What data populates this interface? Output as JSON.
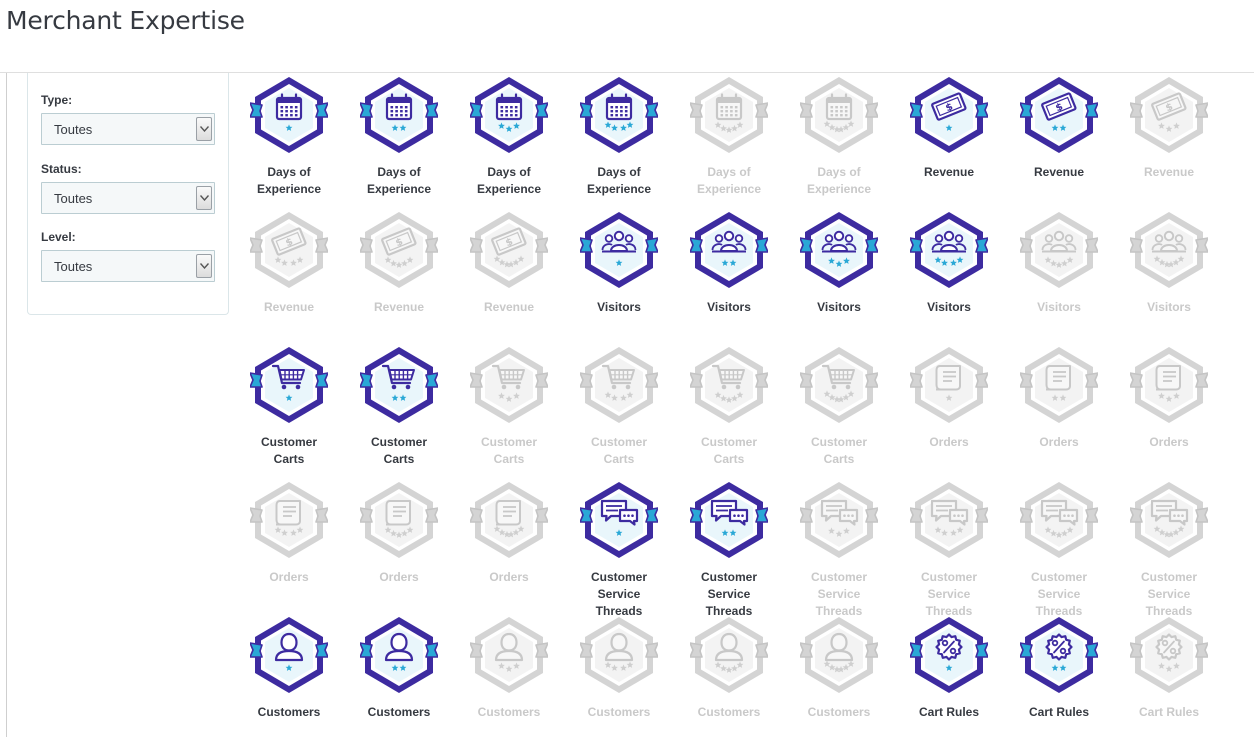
{
  "page": {
    "title": "Merchant Expertise"
  },
  "filters": {
    "type": {
      "label": "Type:",
      "value": "Toutes"
    },
    "status": {
      "label": "Status:",
      "value": "Toutes"
    },
    "level": {
      "label": "Level:",
      "value": "Toutes"
    }
  },
  "colors": {
    "active_hex": "#3d2ba0",
    "active_ribbon": "#2aa8d6",
    "active_fill": "#e9f6fb",
    "star": "#2aa8d6",
    "locked": "#d4d4d4",
    "locked_fill": "#f3f3f3"
  },
  "badges": [
    {
      "name": "Days of Experience",
      "icon": "calendar-icon",
      "stars": 1,
      "unlocked": true
    },
    {
      "name": "Days of Experience",
      "icon": "calendar-icon",
      "stars": 2,
      "unlocked": true
    },
    {
      "name": "Days of Experience",
      "icon": "calendar-icon",
      "stars": 3,
      "unlocked": true
    },
    {
      "name": "Days of Experience",
      "icon": "calendar-icon",
      "stars": 4,
      "unlocked": true
    },
    {
      "name": "Days of Experience",
      "icon": "calendar-icon",
      "stars": 5,
      "unlocked": false
    },
    {
      "name": "Days of Experience",
      "icon": "calendar-icon",
      "stars": 6,
      "unlocked": false
    },
    {
      "name": "Revenue",
      "icon": "money-bill-icon",
      "stars": 1,
      "unlocked": true
    },
    {
      "name": "Revenue",
      "icon": "money-bill-icon",
      "stars": 2,
      "unlocked": true
    },
    {
      "name": "Revenue",
      "icon": "money-bill-icon",
      "stars": 3,
      "unlocked": false
    },
    {
      "name": "Revenue",
      "icon": "money-bill-icon",
      "stars": 4,
      "unlocked": false
    },
    {
      "name": "Revenue",
      "icon": "money-bill-icon",
      "stars": 5,
      "unlocked": false
    },
    {
      "name": "Revenue",
      "icon": "money-bill-icon",
      "stars": 6,
      "unlocked": false
    },
    {
      "name": "Visitors",
      "icon": "people-group-icon",
      "stars": 1,
      "unlocked": true
    },
    {
      "name": "Visitors",
      "icon": "people-group-icon",
      "stars": 2,
      "unlocked": true
    },
    {
      "name": "Visitors",
      "icon": "people-group-icon",
      "stars": 3,
      "unlocked": true
    },
    {
      "name": "Visitors",
      "icon": "people-group-icon",
      "stars": 4,
      "unlocked": true
    },
    {
      "name": "Visitors",
      "icon": "people-group-icon",
      "stars": 5,
      "unlocked": false
    },
    {
      "name": "Visitors",
      "icon": "people-group-icon",
      "stars": 6,
      "unlocked": false
    },
    {
      "name": "Customer Carts",
      "icon": "shopping-cart-icon",
      "stars": 1,
      "unlocked": true
    },
    {
      "name": "Customer Carts",
      "icon": "shopping-cart-icon",
      "stars": 2,
      "unlocked": true
    },
    {
      "name": "Customer Carts",
      "icon": "shopping-cart-icon",
      "stars": 3,
      "unlocked": false
    },
    {
      "name": "Customer Carts",
      "icon": "shopping-cart-icon",
      "stars": 4,
      "unlocked": false
    },
    {
      "name": "Customer Carts",
      "icon": "shopping-cart-icon",
      "stars": 5,
      "unlocked": false
    },
    {
      "name": "Customer Carts",
      "icon": "shopping-cart-icon",
      "stars": 6,
      "unlocked": false
    },
    {
      "name": "Orders",
      "icon": "receipt-icon",
      "stars": 1,
      "unlocked": false
    },
    {
      "name": "Orders",
      "icon": "receipt-icon",
      "stars": 2,
      "unlocked": false
    },
    {
      "name": "Orders",
      "icon": "receipt-icon",
      "stars": 3,
      "unlocked": false
    },
    {
      "name": "Orders",
      "icon": "receipt-icon",
      "stars": 4,
      "unlocked": false
    },
    {
      "name": "Orders",
      "icon": "receipt-icon",
      "stars": 5,
      "unlocked": false
    },
    {
      "name": "Orders",
      "icon": "receipt-icon",
      "stars": 6,
      "unlocked": false
    },
    {
      "name": "Customer Service Threads",
      "icon": "chat-bubbles-icon",
      "stars": 1,
      "unlocked": true
    },
    {
      "name": "Customer Service Threads",
      "icon": "chat-bubbles-icon",
      "stars": 2,
      "unlocked": true
    },
    {
      "name": "Customer Service Threads",
      "icon": "chat-bubbles-icon",
      "stars": 3,
      "unlocked": false
    },
    {
      "name": "Customer Service Threads",
      "icon": "chat-bubbles-icon",
      "stars": 4,
      "unlocked": false
    },
    {
      "name": "Customer Service Threads",
      "icon": "chat-bubbles-icon",
      "stars": 5,
      "unlocked": false
    },
    {
      "name": "Customer Service Threads",
      "icon": "chat-bubbles-icon",
      "stars": 6,
      "unlocked": false
    },
    {
      "name": "Customers",
      "icon": "user-icon",
      "stars": 1,
      "unlocked": true
    },
    {
      "name": "Customers",
      "icon": "user-icon",
      "stars": 2,
      "unlocked": true
    },
    {
      "name": "Customers",
      "icon": "user-icon",
      "stars": 3,
      "unlocked": false
    },
    {
      "name": "Customers",
      "icon": "user-icon",
      "stars": 4,
      "unlocked": false
    },
    {
      "name": "Customers",
      "icon": "user-icon",
      "stars": 5,
      "unlocked": false
    },
    {
      "name": "Customers",
      "icon": "user-icon",
      "stars": 6,
      "unlocked": false
    },
    {
      "name": "Cart Rules",
      "icon": "discount-badge-icon",
      "stars": 1,
      "unlocked": true
    },
    {
      "name": "Cart Rules",
      "icon": "discount-badge-icon",
      "stars": 2,
      "unlocked": true
    },
    {
      "name": "Cart Rules",
      "icon": "discount-badge-icon",
      "stars": 3,
      "unlocked": false
    }
  ]
}
